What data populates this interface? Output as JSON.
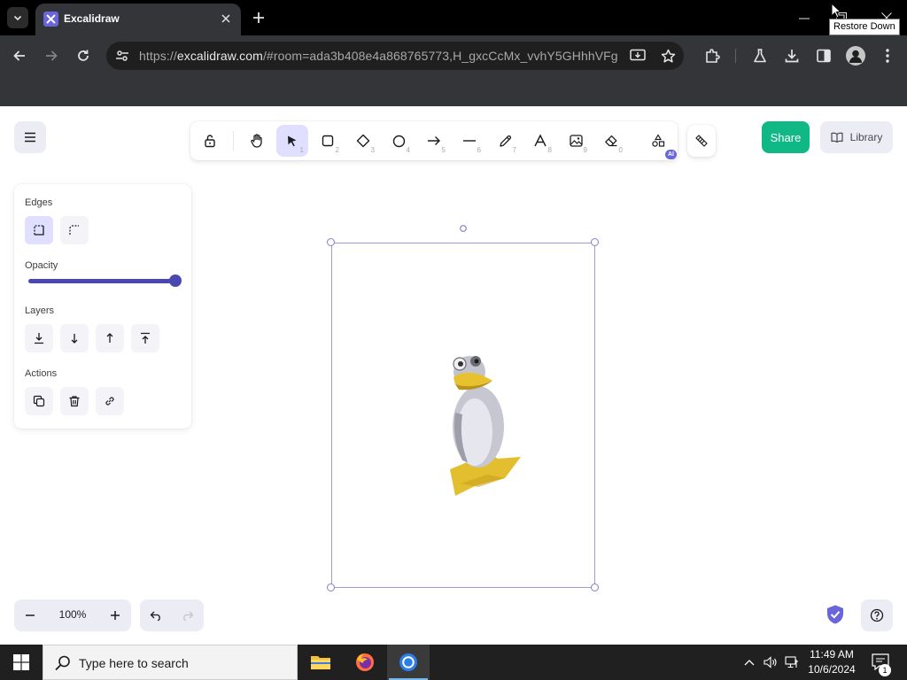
{
  "browser": {
    "tab": {
      "title": "Excalidraw",
      "favicon": "excalidraw-logo-icon"
    },
    "tooltip": "Restore Down",
    "omnibox": {
      "url_scheme": "https://",
      "url_host": "excalidraw.com",
      "url_path": "/#room=ada3b408e4a868765773,H_gxcCcMx_vvhY5GHhhVFg"
    }
  },
  "app": {
    "toolbar": {
      "tools": [
        {
          "name": "lock",
          "icon": "lock-open-icon",
          "key": ""
        },
        {
          "name": "hand",
          "icon": "hand-icon",
          "key": ""
        },
        {
          "name": "selection",
          "icon": "pointer-icon",
          "key": "1",
          "selected": true
        },
        {
          "name": "rectangle",
          "icon": "rectangle-icon",
          "key": "2"
        },
        {
          "name": "diamond",
          "icon": "diamond-icon",
          "key": "3"
        },
        {
          "name": "ellipse",
          "icon": "ellipse-icon",
          "key": "4"
        },
        {
          "name": "arrow",
          "icon": "arrow-icon",
          "key": "5"
        },
        {
          "name": "line",
          "icon": "line-icon",
          "key": "6"
        },
        {
          "name": "draw",
          "icon": "pencil-icon",
          "key": "7"
        },
        {
          "name": "text",
          "icon": "text-icon",
          "key": "8"
        },
        {
          "name": "image",
          "icon": "image-icon",
          "key": "9"
        },
        {
          "name": "eraser",
          "icon": "eraser-icon",
          "key": "0"
        },
        {
          "name": "more-tools",
          "icon": "shapes-icon",
          "key": "",
          "badge": "AI"
        }
      ]
    },
    "share_label": "Share",
    "library_label": "Library",
    "properties": {
      "edges_label": "Edges",
      "opacity_label": "Opacity",
      "opacity_value": 100,
      "layers_label": "Layers",
      "actions_label": "Actions"
    },
    "zoom": {
      "value": "100%"
    },
    "accent_color": "#6965db",
    "share_color": "#0fb884"
  },
  "taskbar": {
    "search_placeholder": "Type here to search",
    "time": "11:49 AM",
    "date": "10/6/2024",
    "notification_count": "1"
  }
}
